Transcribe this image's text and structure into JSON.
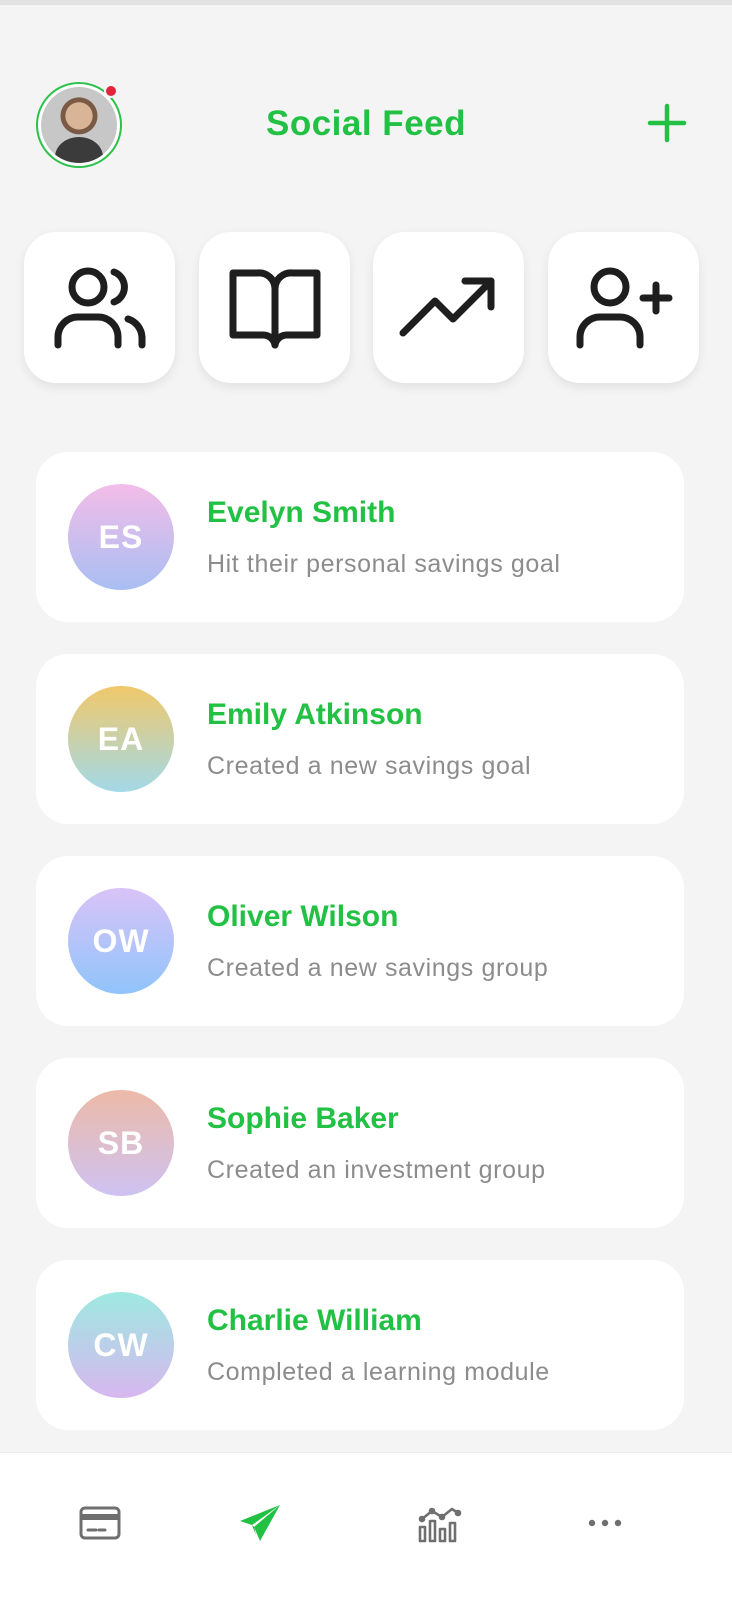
{
  "header": {
    "title": "Social Feed"
  },
  "quick_actions": [
    {
      "icon": "users-icon"
    },
    {
      "icon": "book-icon"
    },
    {
      "icon": "trending-up-icon"
    },
    {
      "icon": "user-plus-icon"
    }
  ],
  "feed": [
    {
      "initials": "ES",
      "name": "Evelyn Smith",
      "activity": "Hit their personal savings goal"
    },
    {
      "initials": "EA",
      "name": "Emily Atkinson",
      "activity": "Created a new savings goal"
    },
    {
      "initials": "OW",
      "name": "Oliver Wilson",
      "activity": "Created a new savings group"
    },
    {
      "initials": "SB",
      "name": "Sophie Baker",
      "activity": "Created an investment group"
    },
    {
      "initials": "CW",
      "name": "Charlie William",
      "activity": "Completed a learning module"
    }
  ],
  "bottom_nav": [
    {
      "icon": "card-icon",
      "active": false
    },
    {
      "icon": "send-icon",
      "active": true
    },
    {
      "icon": "chart-icon",
      "active": false
    },
    {
      "icon": "more-icon",
      "active": false
    }
  ],
  "colors": {
    "accent": "#22c144",
    "text_secondary": "#8c8c8c",
    "background": "#f4f4f4",
    "notification": "#e3253c"
  }
}
